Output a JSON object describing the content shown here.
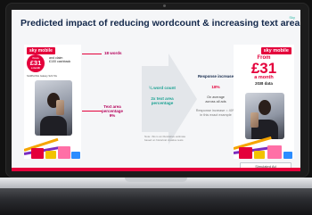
{
  "slide": {
    "title": "Predicted impact of reducing wordcount & increasing text area",
    "corner_tag": "Sky"
  },
  "left_ad": {
    "brand": "sky mobile",
    "price_prefix": "From",
    "price": "£31",
    "price_suffix": "a month",
    "offer_lines": [
      "and claim",
      "£100 cashback"
    ],
    "device_line": "SAMSUNG Galaxy S21 5G"
  },
  "right_ad": {
    "brand": "sky mobile",
    "price_prefix": "From",
    "price": "£31",
    "price_suffix": "a month",
    "data_line": "2GB data"
  },
  "callouts": {
    "words": "18 words",
    "text_area": [
      "Text area",
      "percentage",
      "9%"
    ]
  },
  "arrow": {
    "word_count": "¼ word count",
    "text_area": [
      "2x text area",
      "percentage"
    ],
    "note": [
      "Note: this is an illustrative estimate",
      "based on historical creative tests"
    ]
  },
  "stats": {
    "response_label": "Response increase",
    "response_value": "18%",
    "avg_label": [
      "On average",
      "across all ads"
    ],
    "example": [
      "Response increase = 40%",
      "in this exact example"
    ]
  },
  "button": {
    "label": "Simulated Ad"
  },
  "colors": {
    "brand": "#e4003b",
    "accent": "#1aa192",
    "navy": "#12274a"
  }
}
